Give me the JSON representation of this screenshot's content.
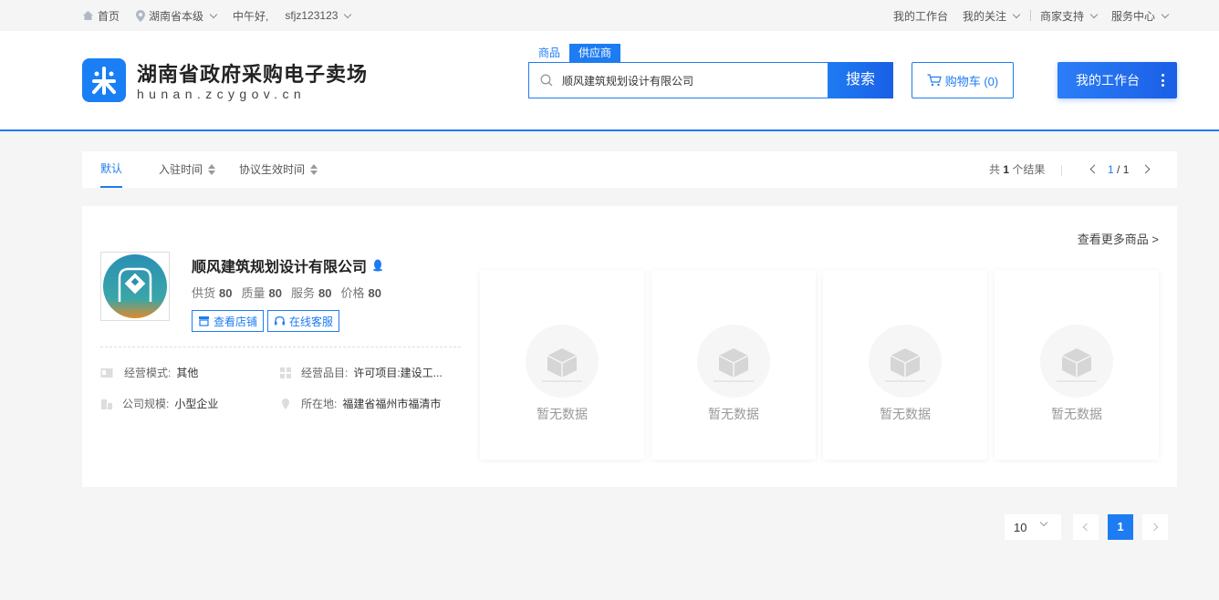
{
  "topbar": {
    "home": "首页",
    "region": "湖南省本级",
    "greeting": "中午好,",
    "username": "sfjz123123",
    "right": [
      "我的工作台",
      "我的关注",
      "商家支持",
      "服务中心"
    ]
  },
  "header": {
    "site_title": "湖南省政府采购电子卖场",
    "site_domain": "hunan.zcygov.cn",
    "search_tabs": [
      "商品",
      "供应商"
    ],
    "search_value": "顺风建筑规划设计有限公司",
    "search_button": "搜索",
    "cart_label": "购物车 (0)",
    "workspace_button": "我的工作台"
  },
  "sortbar": {
    "items": [
      "默认",
      "入驻时间",
      "协议生效时间"
    ],
    "count_prefix": "共",
    "count": "1",
    "count_suffix": "个结果",
    "page_current": "1",
    "page_total": "/ 1"
  },
  "supplier": {
    "more_link": "查看更多商品 >",
    "name": "顺风建筑规划设计有限公司",
    "scores": [
      {
        "label": "供货",
        "value": "80"
      },
      {
        "label": "质量",
        "value": "80"
      },
      {
        "label": "服务",
        "value": "80"
      },
      {
        "label": "价格",
        "value": "80"
      }
    ],
    "view_shop": "查看店铺",
    "online_service": "在线客服",
    "info": {
      "mode_label": "经营模式:",
      "mode_value": "其他",
      "category_label": "经营品目:",
      "category_value": "许可项目:建设工...",
      "scale_label": "公司规模:",
      "scale_value": "小型企业",
      "location_label": "所在地:",
      "location_value": "福建省福州市福清市"
    },
    "empty_text": "暂无数据"
  },
  "pagination": {
    "page_size": "10",
    "current": "1"
  },
  "colors": {
    "primary": "#1e7cf2"
  }
}
